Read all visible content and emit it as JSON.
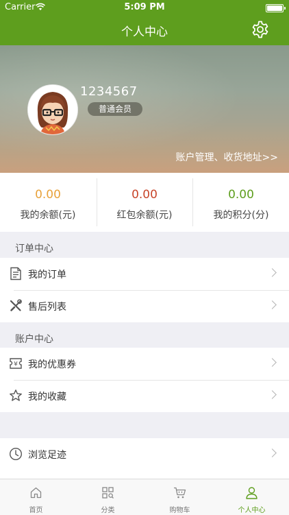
{
  "status_bar": {
    "carrier": "Carrier",
    "time": "5:09 PM"
  },
  "nav": {
    "title": "个人中心",
    "settings_icon": "gear-icon"
  },
  "profile": {
    "username": "1234567",
    "member_level": "普通会员",
    "account_link": "账户管理、收货地址>>"
  },
  "stats": [
    {
      "value": "0.00",
      "label": "我的余额(元)",
      "color": "#e8a23b"
    },
    {
      "value": "0.00",
      "label": "红包余额(元)",
      "color": "#c8452a"
    },
    {
      "value": "0.00",
      "label": "我的积分(分)",
      "color": "#5e9e1e"
    }
  ],
  "sections": {
    "orders": {
      "title": "订单中心",
      "items": [
        {
          "label": "我的订单",
          "icon": "document-list-icon"
        },
        {
          "label": "售后列表",
          "icon": "tools-icon"
        }
      ]
    },
    "account": {
      "title": "账户中心",
      "items": [
        {
          "label": "我的优惠券",
          "icon": "coupon-icon"
        },
        {
          "label": "我的收藏",
          "icon": "star-icon"
        }
      ]
    },
    "other": {
      "items": [
        {
          "label": "浏览足迹",
          "icon": "clock-icon"
        }
      ]
    }
  },
  "tabs": [
    {
      "label": "首页",
      "icon": "home-icon"
    },
    {
      "label": "分类",
      "icon": "category-grid-icon"
    },
    {
      "label": "购物车",
      "icon": "cart-icon"
    },
    {
      "label": "个人中心",
      "icon": "person-icon",
      "active": true
    }
  ],
  "colors": {
    "brand_green": "#5e9e1e",
    "background": "#efeff4"
  }
}
